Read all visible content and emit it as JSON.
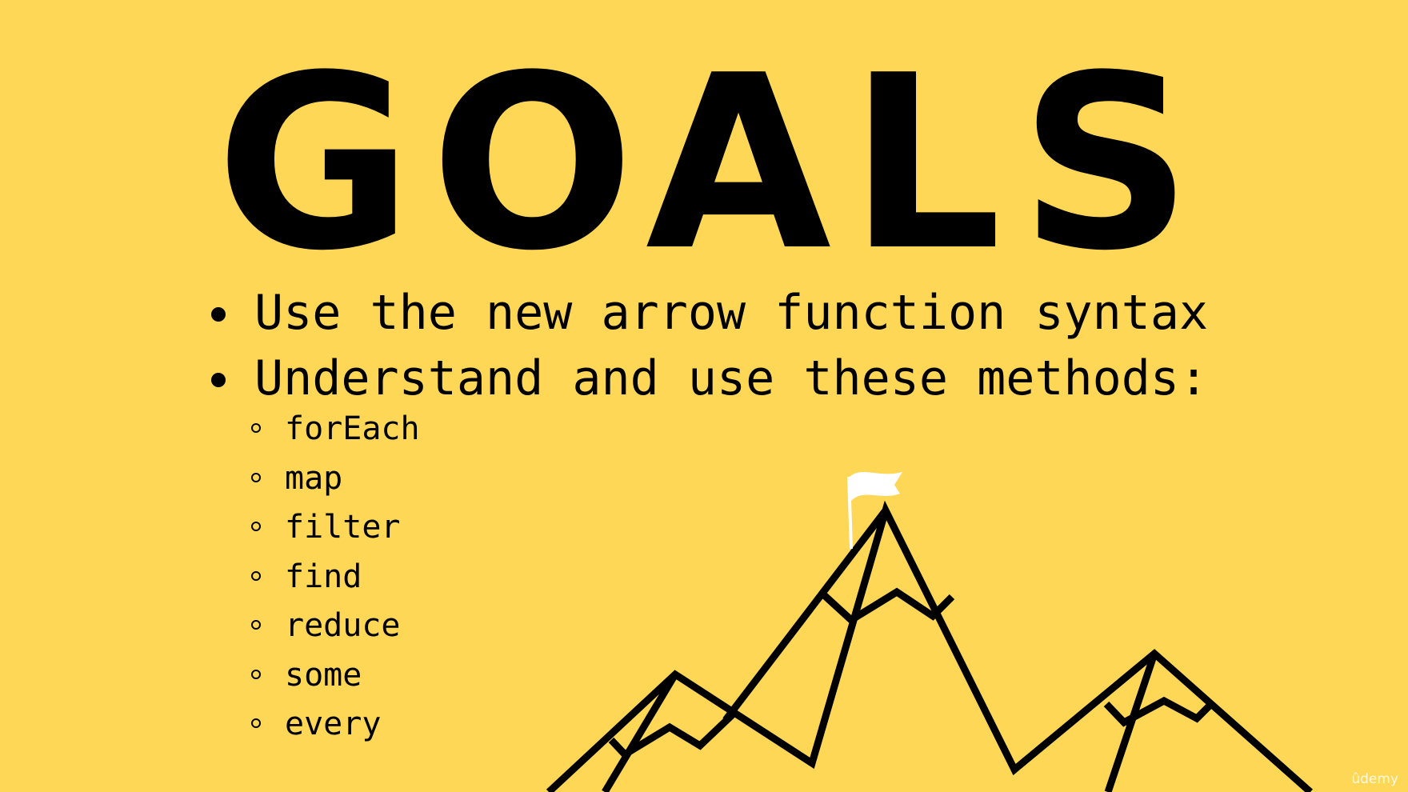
{
  "slide": {
    "title": "GOALS",
    "bullets": [
      "Use the new arrow function syntax",
      "Understand and use these methods:"
    ],
    "methods": [
      "forEach",
      "map",
      "filter",
      "find",
      "reduce",
      "some",
      "every"
    ],
    "watermark": "ûdemy"
  },
  "illustration": {
    "icon": "mountain-with-flag",
    "line_color": "#000000",
    "flag_color": "#ffffff"
  },
  "colors": {
    "background": "#fdd755",
    "text": "#000000"
  }
}
